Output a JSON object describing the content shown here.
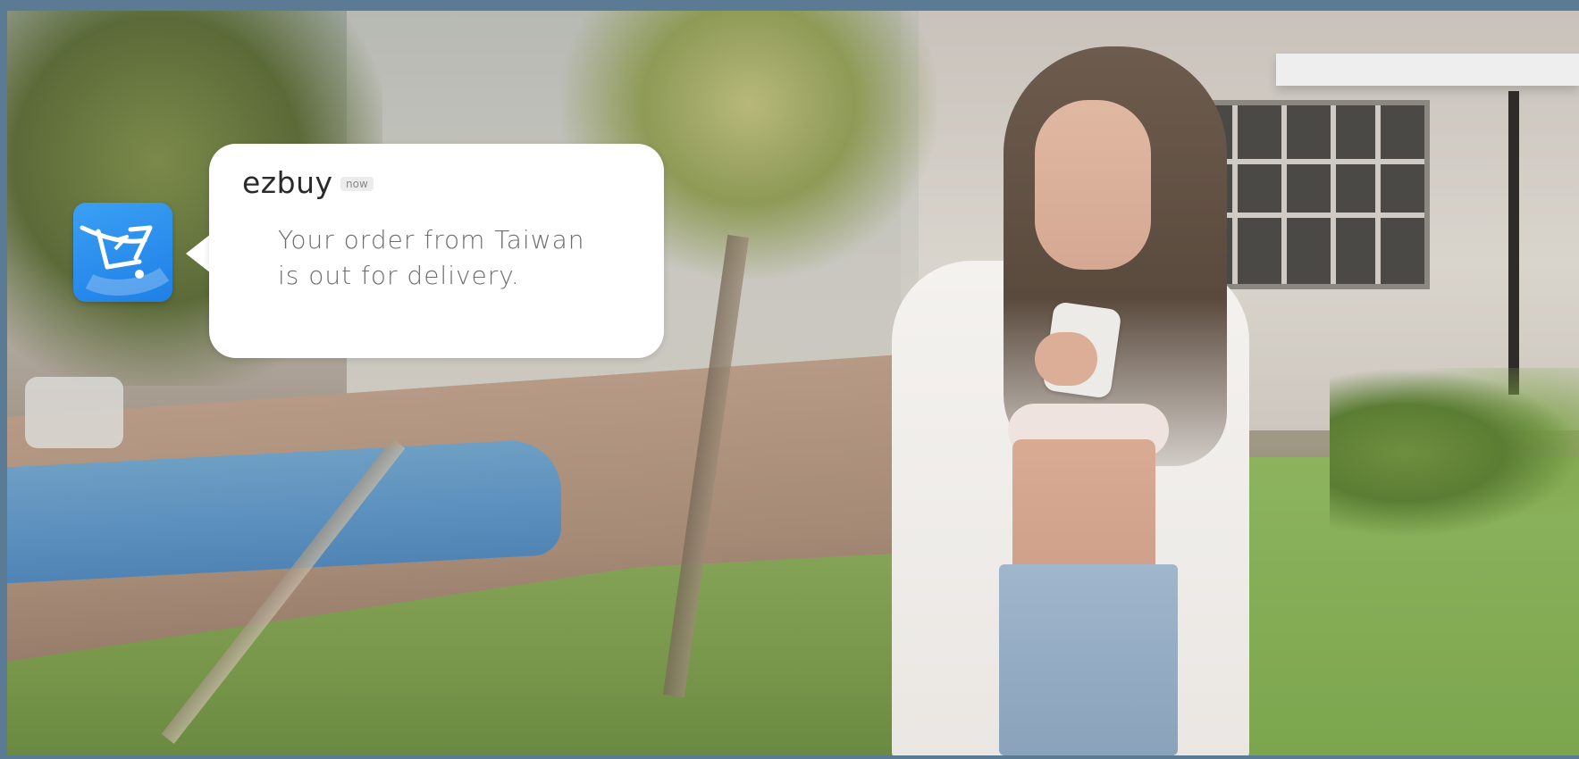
{
  "notification": {
    "app_name": "ezbuy",
    "time": "now",
    "message_lines": [
      "Your order from Taiwan",
      "is out for delivery."
    ],
    "icon": "ezbuy-cart-icon"
  },
  "colors": {
    "frame": "#5b7a93",
    "icon_blue": "#2a8ef0",
    "bubble": "#ffffff"
  }
}
